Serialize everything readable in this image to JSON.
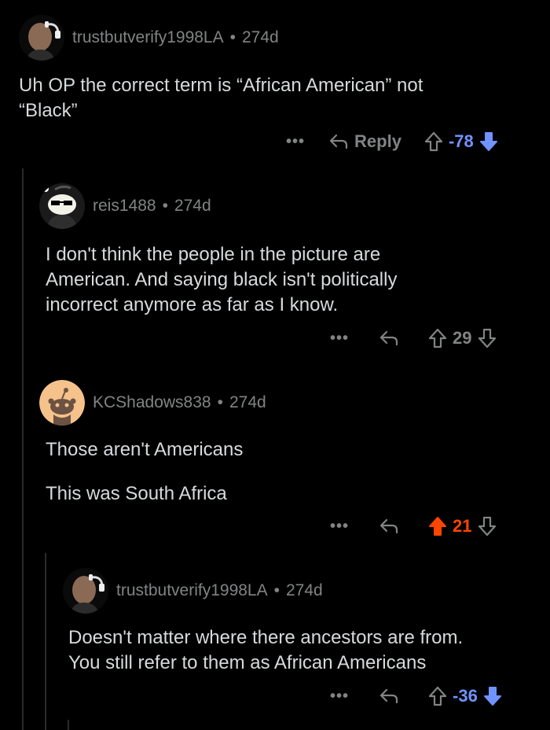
{
  "colors": {
    "background": "#000000",
    "text": "#d7dadc",
    "muted": "#818384",
    "downvote": "#7193ff",
    "upvote": "#ff4500",
    "thread_line": "#2a2a2b"
  },
  "comments": [
    {
      "username": "trustbutverify1998LA",
      "age": "274d",
      "avatar": "person-headphones-avatar",
      "lines": [
        "Uh OP the correct term is “African American” not",
        "“Black”"
      ],
      "reply_label": "Reply",
      "score": "-78",
      "vote_state": "down"
    },
    {
      "username": "reis1488",
      "age": "274d",
      "avatar": "sunglasses-snoo-avatar",
      "lines": [
        "I don't think the people in the picture are",
        "American. And saying black isn't politically",
        "incorrect anymore as far as I know."
      ],
      "score": "29",
      "vote_state": "none"
    },
    {
      "username": "KCShadows838",
      "age": "274d",
      "avatar": "default-snoo-avatar",
      "lines": [
        "Those aren't Americans",
        "",
        "This was South Africa"
      ],
      "score": "21",
      "vote_state": "up"
    },
    {
      "username": "trustbutverify1998LA",
      "age": "274d",
      "avatar": "person-headphones-avatar",
      "lines": [
        "Doesn't matter where there ancestors are from.",
        "You still refer to them as African Americans"
      ],
      "score": "-36",
      "vote_state": "down"
    }
  ]
}
